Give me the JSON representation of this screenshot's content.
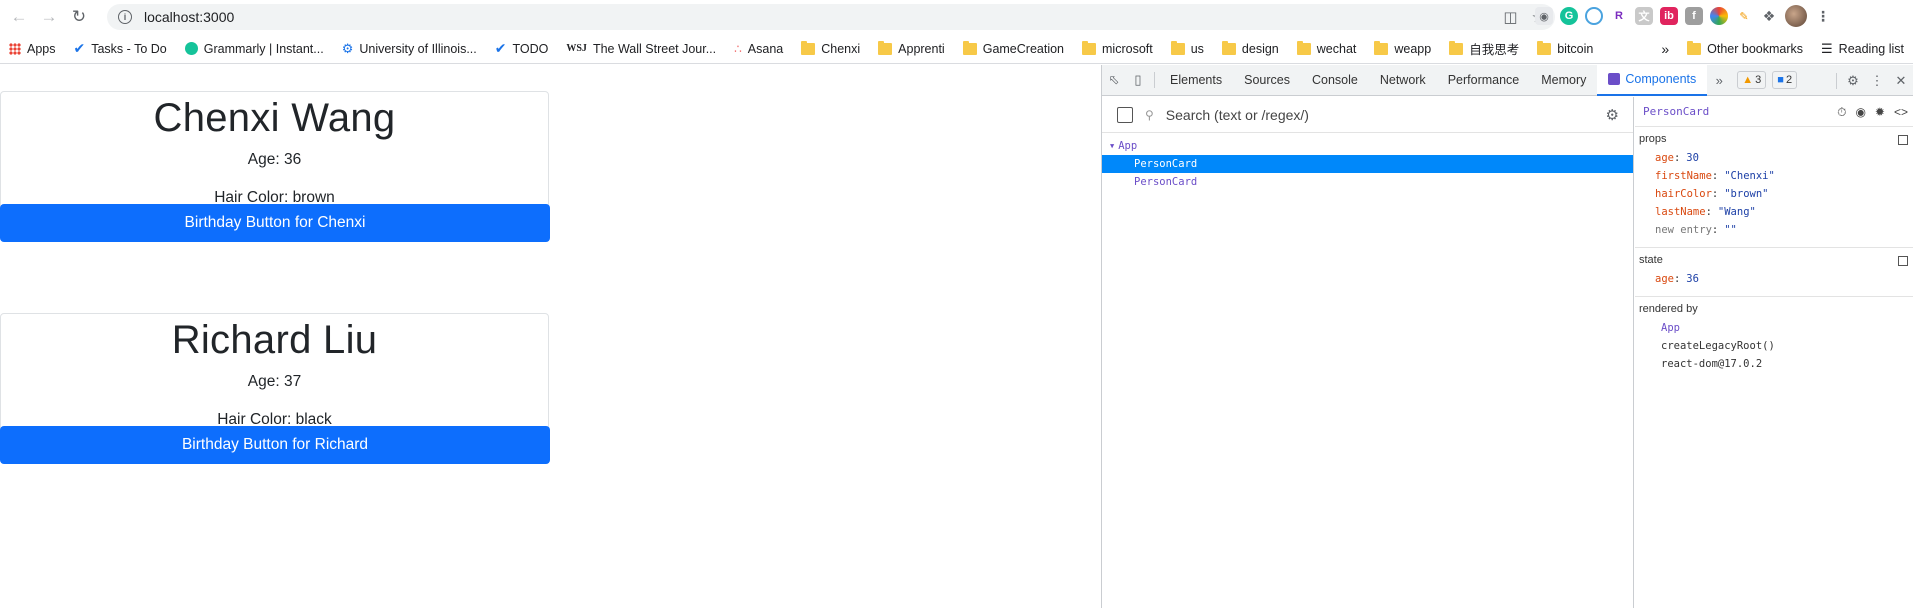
{
  "browser": {
    "url": "localhost:3000",
    "bookmarks": [
      {
        "label": "Apps",
        "icon": "apps-grid-icon"
      },
      {
        "label": "Tasks - To Do",
        "icon": "check-icon"
      },
      {
        "label": "Grammarly | Instant...",
        "icon": "grammarly-icon"
      },
      {
        "label": "University of Illinois...",
        "icon": "gear-logo-icon"
      },
      {
        "label": "TODO",
        "icon": "check-icon"
      },
      {
        "label": "The Wall Street Jour...",
        "icon": "wsj-icon"
      },
      {
        "label": "Asana",
        "icon": "asana-icon"
      },
      {
        "label": "Chenxi",
        "icon": "folder-icon"
      },
      {
        "label": "Apprenti",
        "icon": "folder-icon"
      },
      {
        "label": "GameCreation",
        "icon": "folder-icon"
      },
      {
        "label": "microsoft",
        "icon": "folder-icon"
      },
      {
        "label": "us",
        "icon": "folder-icon"
      },
      {
        "label": "design",
        "icon": "folder-icon"
      },
      {
        "label": "wechat",
        "icon": "folder-icon"
      },
      {
        "label": "weapp",
        "icon": "folder-icon"
      },
      {
        "label": "自我思考",
        "icon": "folder-icon"
      },
      {
        "label": "bitcoin",
        "icon": "folder-icon"
      }
    ],
    "other_bookmarks": "Other bookmarks",
    "reading_list": "Reading list",
    "wsj_mark": "WSJ"
  },
  "page": {
    "cards": [
      {
        "name": "Chenxi Wang",
        "age": "Age: 36",
        "hair": "Hair Color: brown",
        "button": "Birthday Button for Chenxi"
      },
      {
        "name": "Richard Liu",
        "age": "Age: 37",
        "hair": "Hair Color: black",
        "button": "Birthday Button for Richard"
      }
    ]
  },
  "devtools": {
    "tabs": [
      "Elements",
      "Sources",
      "Console",
      "Network",
      "Performance",
      "Memory",
      "Components"
    ],
    "active_tab": "Components",
    "warnings": "3",
    "messages": "2",
    "search_placeholder": "Search (text or /regex/)",
    "tree": {
      "root": "App",
      "children": [
        "PersonCard",
        "PersonCard"
      ]
    },
    "selected": "PersonCard",
    "props_title": "props",
    "props": [
      {
        "key": "age",
        "value": "30"
      },
      {
        "key": "firstName",
        "value": "\"Chenxi\""
      },
      {
        "key": "hairColor",
        "value": "\"brown\""
      },
      {
        "key": "lastName",
        "value": "\"Wang\""
      },
      {
        "key": "new entry",
        "value": "\"\""
      }
    ],
    "state_title": "state",
    "state": [
      {
        "key": "age",
        "value": "36"
      }
    ],
    "rendered_by_title": "rendered by",
    "rendered_by": [
      "App",
      "createLegacyRoot()",
      "react-dom@17.0.2"
    ]
  },
  "colors": {
    "primary_button": "#0d6efd",
    "selection": "#0088fa",
    "component_name": "#6b4ec8"
  }
}
